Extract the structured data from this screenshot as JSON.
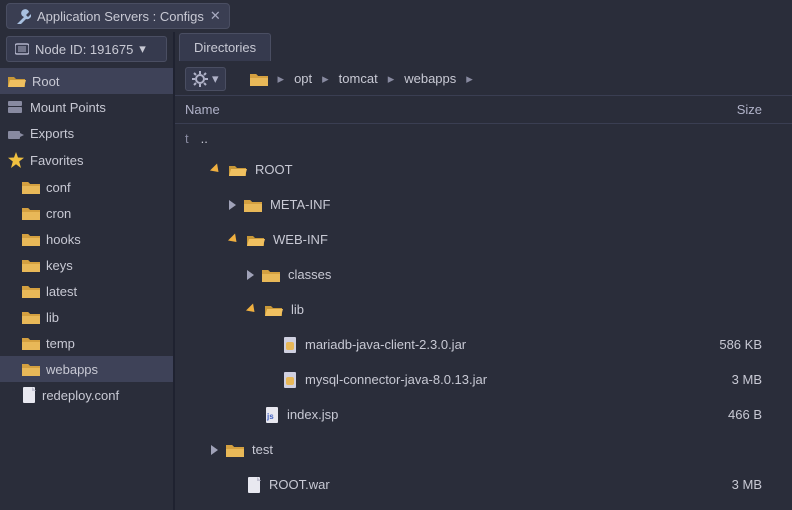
{
  "window": {
    "title": "Application Servers : Configs"
  },
  "sidebar": {
    "nodeLabel": "Node ID: 191675",
    "root": "Root",
    "mountPoints": "Mount Points",
    "exports": "Exports",
    "favoritesHeader": "Favorites",
    "favorites": [
      {
        "key": "conf",
        "label": "conf"
      },
      {
        "key": "cron",
        "label": "cron"
      },
      {
        "key": "hooks",
        "label": "hooks"
      },
      {
        "key": "keys",
        "label": "keys"
      },
      {
        "key": "latest",
        "label": "latest"
      },
      {
        "key": "lib",
        "label": "lib"
      },
      {
        "key": "temp",
        "label": "temp"
      },
      {
        "key": "webapps",
        "label": "webapps",
        "selected": true
      },
      {
        "key": "redeploy",
        "label": "redeploy.conf",
        "file": true
      }
    ]
  },
  "content": {
    "tabLabel": "Directories",
    "breadcrumbs": [
      "opt",
      "tomcat",
      "webapps"
    ],
    "columns": {
      "name": "Name",
      "size": "Size"
    },
    "parentRow": "..",
    "parentIcon": "t",
    "rows": [
      {
        "indent": 0,
        "tri": "open",
        "icon": "folder-open",
        "name": "ROOT",
        "size": ""
      },
      {
        "indent": 1,
        "tri": "closed",
        "icon": "folder",
        "name": "META-INF",
        "size": ""
      },
      {
        "indent": 1,
        "tri": "open",
        "icon": "folder-open",
        "name": "WEB-INF",
        "size": ""
      },
      {
        "indent": 2,
        "tri": "closed",
        "icon": "folder",
        "name": "classes",
        "size": ""
      },
      {
        "indent": 2,
        "tri": "open",
        "icon": "folder-open",
        "name": "lib",
        "size": ""
      },
      {
        "indent": 3,
        "tri": "none",
        "icon": "jar",
        "name": "mariadb-java-client-2.3.0.jar",
        "size": "586 KB"
      },
      {
        "indent": 3,
        "tri": "none",
        "icon": "jar",
        "name": "mysql-connector-java-8.0.13.jar",
        "size": "3 MB"
      },
      {
        "indent": 2,
        "tri": "none",
        "icon": "js",
        "name": "index.jsp",
        "size": "466 B"
      },
      {
        "indent": 0,
        "tri": "closed",
        "icon": "folder",
        "name": "test",
        "size": ""
      },
      {
        "indent": 1,
        "tri": "none",
        "icon": "file",
        "name": "ROOT.war",
        "size": "3 MB"
      }
    ]
  }
}
